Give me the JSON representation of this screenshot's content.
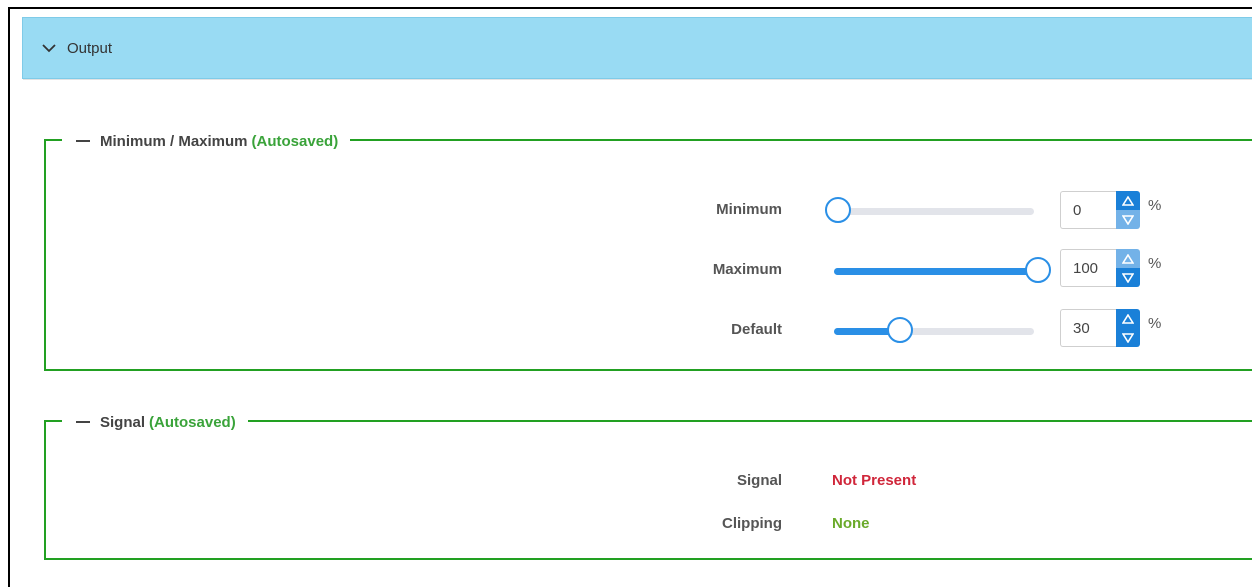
{
  "panel": {
    "title": "Output",
    "expanded": true,
    "icon": "chevron-down-icon"
  },
  "colors": {
    "header_bg": "#99dbf3",
    "group_border": "#22a022",
    "accent": "#1a80d8",
    "autosaved": "#3aa33a",
    "not_present": "#d0263a",
    "none": "#6aaa2a"
  },
  "minmax_group": {
    "title": "Minimum / Maximum",
    "status": "(Autosaved)",
    "unit": "%",
    "rows": [
      {
        "label": "Minimum",
        "value": "0",
        "percent": 0
      },
      {
        "label": "Maximum",
        "value": "100",
        "percent": 100
      },
      {
        "label": "Default",
        "value": "30",
        "percent": 30
      }
    ]
  },
  "signal_group": {
    "title": "Signal",
    "status": "(Autosaved)",
    "rows": [
      {
        "label": "Signal",
        "value": "Not Present",
        "status": "error"
      },
      {
        "label": "Clipping",
        "value": "None",
        "status": "ok"
      }
    ]
  }
}
